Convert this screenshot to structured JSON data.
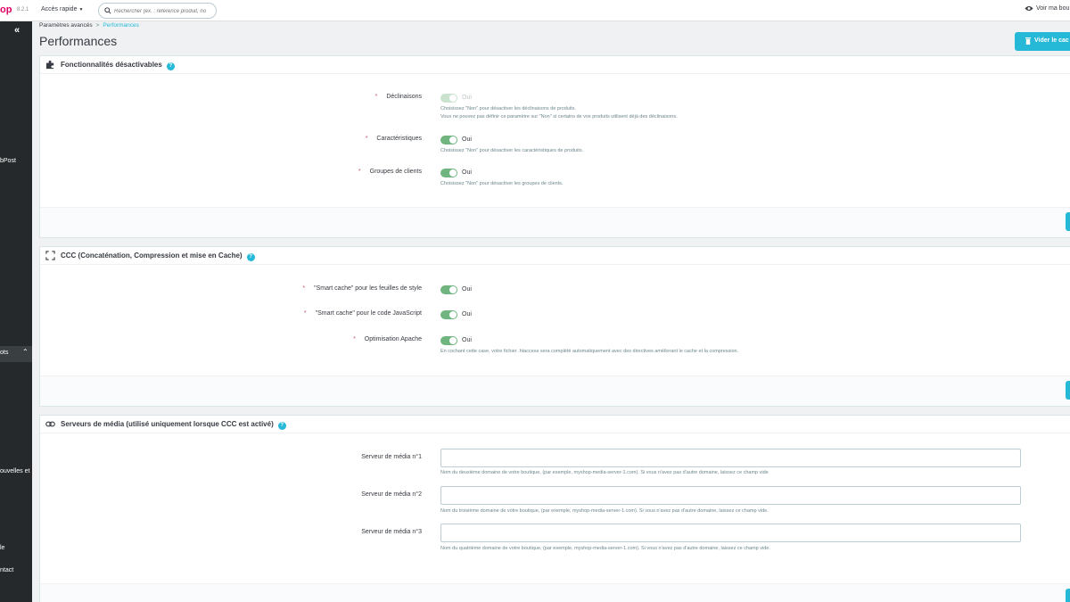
{
  "topbar": {
    "logo": "op",
    "version": "8.2.1",
    "quick_access": "Accès rapide",
    "search_placeholder": "Rechercher (ex. : référence produit, no",
    "view_shop": "Voir ma bou"
  },
  "sidebar": {
    "collapse_glyph": "«",
    "items": [
      {
        "label": "bPost"
      },
      {
        "label": "ots"
      },
      {
        "label": "ouvelles et"
      },
      {
        "label": "le"
      },
      {
        "label": "ntact"
      }
    ]
  },
  "header": {
    "breadcrumb_parent": "Paramètres avancés",
    "breadcrumb_separator": ">",
    "breadcrumb_current": "Performances",
    "title": "Performances",
    "clear_cache_button": "Vider le cac"
  },
  "features_panel": {
    "title": "Fonctionnalités désactivables",
    "icon": "puzzle-icon",
    "rows": [
      {
        "label": "Déclinaisons",
        "value": "Oui",
        "enabled": true,
        "disabled": true,
        "hints": [
          "Choisissez \"Non\" pour désactiver les déclinaisons de produits.",
          "Vous ne pouvez pas définir ce paramètre sur \"Non\" si certains de vos produits utilisent déjà des déclinaisons."
        ]
      },
      {
        "label": "Caractéristiques",
        "value": "Oui",
        "enabled": true,
        "disabled": false,
        "hints": [
          "Choisissez \"Non\" pour désactiver les caractéristiques de produits."
        ]
      },
      {
        "label": "Groupes de clients",
        "value": "Oui",
        "enabled": true,
        "disabled": false,
        "hints": [
          "Choisissez \"Non\" pour désactiver les groupes de clients."
        ]
      }
    ]
  },
  "ccc_panel": {
    "title": "CCC (Concaténation, Compression et mise en Cache)",
    "icon": "expand-icon",
    "rows": [
      {
        "label": "\"Smart cache\" pour les feuilles de style",
        "value": "Oui",
        "enabled": true
      },
      {
        "label": "\"Smart cache\" pour le code JavaScript",
        "value": "Oui",
        "enabled": true
      },
      {
        "label": "Optimisation Apache",
        "value": "Oui",
        "enabled": true,
        "hint": "En cochant cette case, votre fichier .htaccess sera complété automatiquement avec des directives améliorant le cache et la compression."
      }
    ]
  },
  "media_panel": {
    "title": "Serveurs de média (utilisé uniquement lorsque CCC est activé)",
    "icon": "link-icon",
    "rows": [
      {
        "label": "Serveur de média n°1",
        "value": "",
        "hint": "Nom du deuxième domaine de votre boutique, (par exemple, myshop-media-server-1.com). Si vous n'avez pas d'autre domaine, laissez ce champ vide"
      },
      {
        "label": "Serveur de média n°2",
        "value": "",
        "hint": "Nom du troisième domaine de votre boutique, (par exemple, myshop-media-server-1.com). Si vous n'avez pas d'autre domaine, laissez ce champ vide."
      },
      {
        "label": "Serveur de média n°3",
        "value": "",
        "hint": "Nom du quatrième domaine de votre boutique, (par exemple, myshop-media-server-1.com). Si vous n'avez pas d'autre domaine, laissez ce champ vide."
      }
    ]
  },
  "colors": {
    "accent": "#25b9d7",
    "switch_on": "#70b580",
    "sidebar": "#25292b",
    "brand": "#df0067"
  }
}
